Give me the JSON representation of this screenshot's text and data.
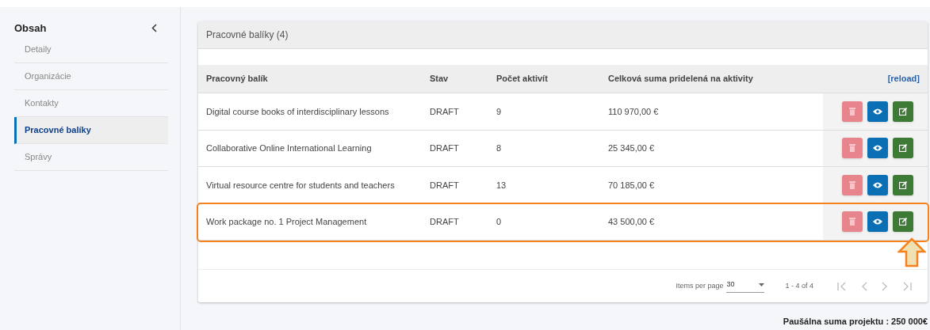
{
  "sidebar": {
    "title": "Obsah",
    "items": [
      {
        "label": "Detaily",
        "selected": false
      },
      {
        "label": "Organizácie",
        "selected": false
      },
      {
        "label": "Kontakty",
        "selected": false
      },
      {
        "label": "Pracovné balíky",
        "selected": true
      },
      {
        "label": "Správy",
        "selected": false
      }
    ]
  },
  "card": {
    "title": "Pracovné balíky (4)",
    "table": {
      "columns": [
        "Pracovný balík",
        "Stav",
        "Počet aktivít",
        "Celková suma pridelená na aktivity"
      ],
      "reload": "[reload]",
      "rows": [
        {
          "cells": [
            "Digital course books of interdisciplinary lessons",
            "DRAFT",
            "9",
            "110 970,00 €"
          ],
          "highlighted": false
        },
        {
          "cells": [
            "Collaborative Online International Learning",
            "DRAFT",
            "8",
            "25 345,00 €"
          ],
          "highlighted": false
        },
        {
          "cells": [
            "Virtual resource centre for students and teachers",
            "DRAFT",
            "13",
            "70 185,00 €"
          ],
          "highlighted": false
        },
        {
          "cells": [
            "Work package no. 1 Project Management",
            "DRAFT",
            "0",
            "43 500,00 €"
          ],
          "highlighted": true
        }
      ]
    },
    "paginator": {
      "items_per_page_label": "Items per page",
      "page_size": "30",
      "range": "1 - 4 of 4"
    }
  },
  "footer": "Paušálna suma projektu : 250 000€"
}
